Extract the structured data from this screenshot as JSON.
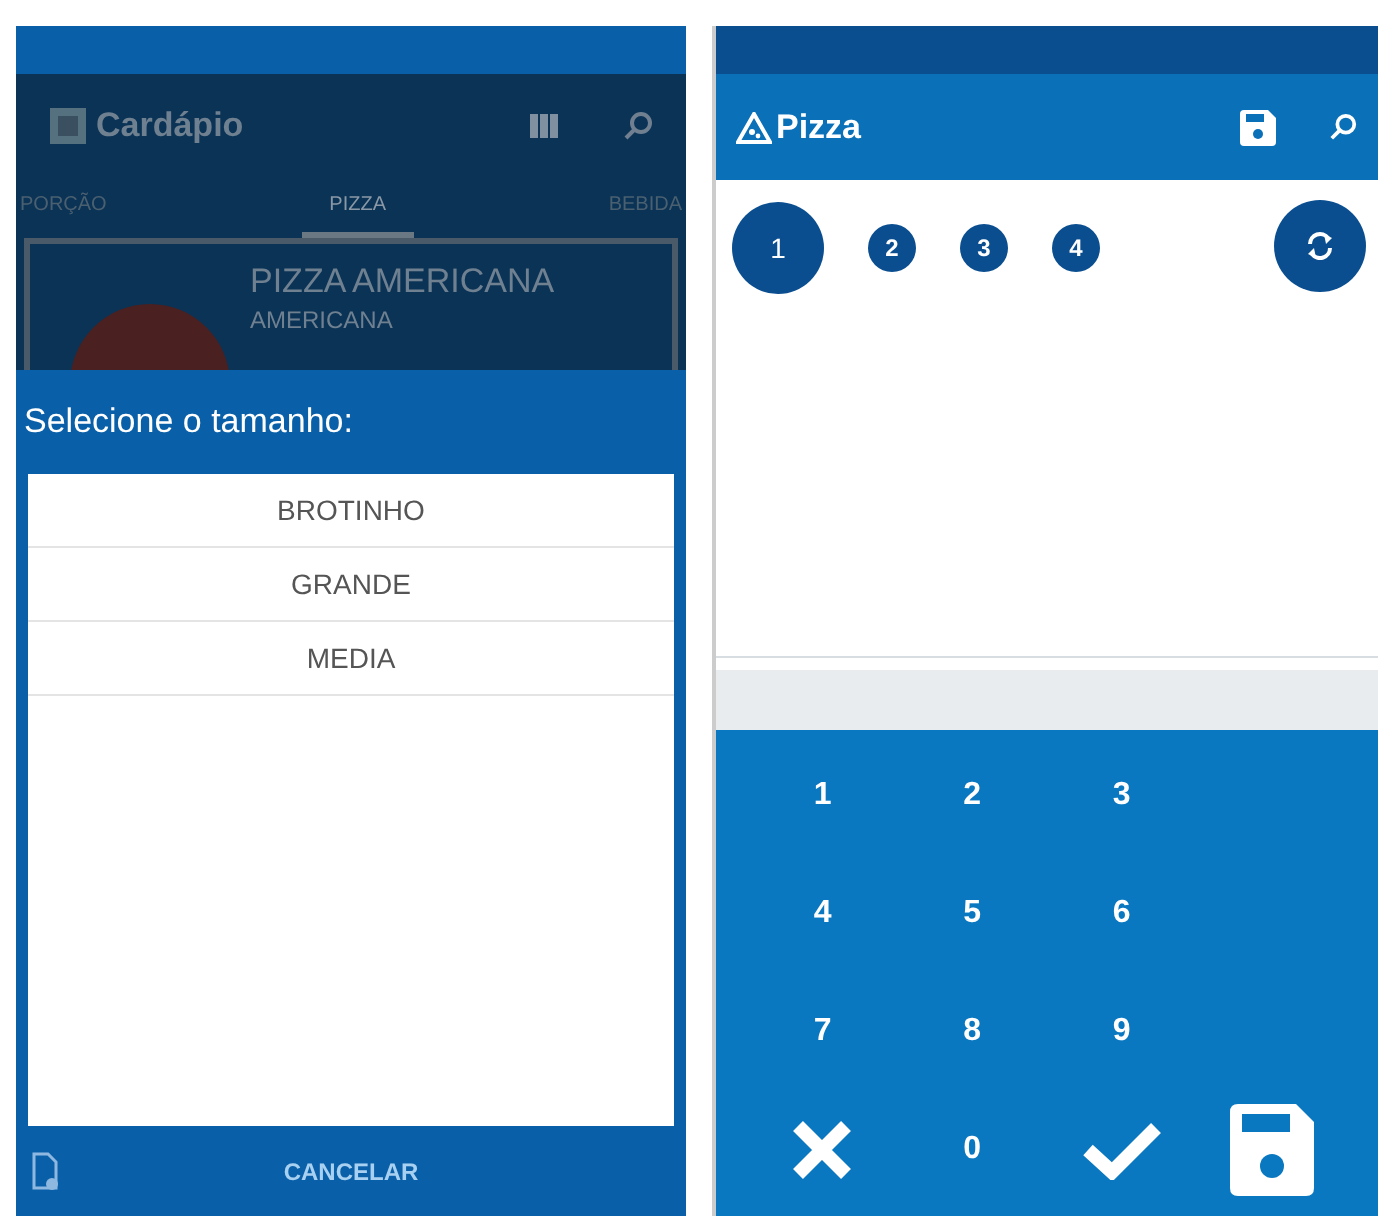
{
  "left_screen": {
    "toolbar": {
      "title": "Cardápio"
    },
    "tabs": [
      {
        "label": "PORÇÃO",
        "selected": false
      },
      {
        "label": "PIZZA",
        "selected": true
      },
      {
        "label": "BEBIDA",
        "selected": false
      }
    ],
    "product_card": {
      "name": "PIZZA AMERICANA",
      "subtitle": "AMERICANA"
    },
    "dialog": {
      "title": "Selecione o tamanho:",
      "options": [
        "BROTINHO",
        "GRANDE",
        "MEDIA"
      ],
      "cancel_button": "CANCELAR"
    }
  },
  "right_screen": {
    "toolbar": {
      "title": "Pizza"
    },
    "steps": [
      {
        "label": "1",
        "selected": true
      },
      {
        "label": "2",
        "selected": false
      },
      {
        "label": "3",
        "selected": false
      },
      {
        "label": "4",
        "selected": false
      }
    ],
    "keypad": [
      {
        "kind": "digit",
        "label": "1"
      },
      {
        "kind": "digit",
        "label": "2"
      },
      {
        "kind": "digit",
        "label": "3"
      },
      {
        "kind": "blank"
      },
      {
        "kind": "digit",
        "label": "4"
      },
      {
        "kind": "digit",
        "label": "5"
      },
      {
        "kind": "digit",
        "label": "6"
      },
      {
        "kind": "blank"
      },
      {
        "kind": "digit",
        "label": "7"
      },
      {
        "kind": "digit",
        "label": "8"
      },
      {
        "kind": "digit",
        "label": "9"
      },
      {
        "kind": "blank"
      },
      {
        "kind": "clear"
      },
      {
        "kind": "digit",
        "label": "0"
      },
      {
        "kind": "confirm"
      },
      {
        "kind": "save"
      }
    ]
  }
}
